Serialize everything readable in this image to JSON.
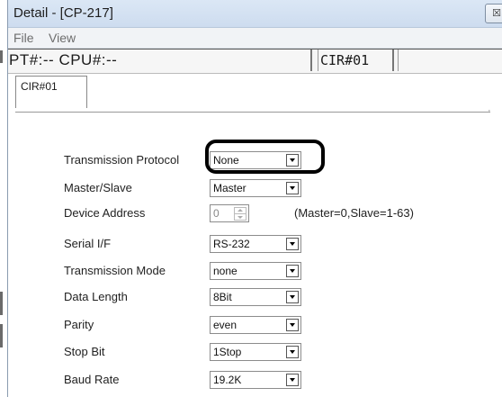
{
  "window": {
    "title": "Detail - [CP-217]",
    "close_glyph": "☒"
  },
  "menu": {
    "file": "File",
    "view": "View"
  },
  "status": {
    "pt_cpu": "PT#:-- CPU#:--",
    "cir": "CIR#01",
    "extra": ""
  },
  "tabs": [
    "CIR#01"
  ],
  "fields": [
    {
      "label": "Transmission Protocol",
      "value": "None",
      "kind": "combo"
    },
    {
      "label": "Master/Slave",
      "value": "Master",
      "kind": "combo"
    },
    {
      "label": "Device Address",
      "value": "0",
      "kind": "spin",
      "hint": "(Master=0,Slave=1-63)"
    },
    {
      "label": "Serial I/F",
      "value": "RS-232",
      "kind": "combo"
    },
    {
      "label": "Transmission Mode",
      "value": "none",
      "kind": "combo"
    },
    {
      "label": "Data Length",
      "value": "8Bit",
      "kind": "combo"
    },
    {
      "label": "Parity",
      "value": "even",
      "kind": "combo"
    },
    {
      "label": "Stop Bit",
      "value": "1Stop",
      "kind": "combo"
    },
    {
      "label": "Baud Rate",
      "value": "19.2K",
      "kind": "combo"
    }
  ],
  "colors": {
    "titlebar": "#cddcef",
    "highlight_ring": "#000000"
  }
}
